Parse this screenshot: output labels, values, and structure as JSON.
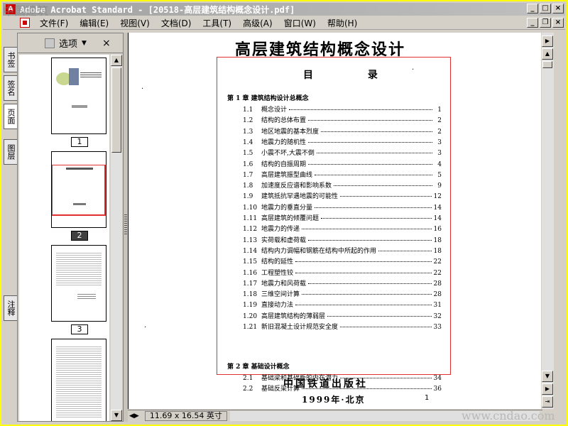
{
  "window": {
    "title": "Adobe Acrobat Standard - [20518-高层建筑结构概念设计.pdf]",
    "watermark_top": "中国建筑",
    "watermark_bottom": "www.cndao.com"
  },
  "menu": {
    "items": [
      "文件(F)",
      "编辑(E)",
      "视图(V)",
      "文档(D)",
      "工具(T)",
      "高级(A)",
      "窗口(W)",
      "帮助(H)"
    ]
  },
  "side_tabs": [
    "书签",
    "签名",
    "页面",
    "图层",
    "注释"
  ],
  "pages_panel": {
    "options_label": "选项",
    "thumbnails": [
      {
        "label": "1",
        "selected": false
      },
      {
        "label": "2",
        "selected": true
      },
      {
        "label": "3",
        "selected": false
      },
      {
        "label": "",
        "selected": false
      }
    ]
  },
  "status": {
    "page_size": "11.69 x 16.54 英寸"
  },
  "document": {
    "title": "高层建筑结构概念设计",
    "toc_heading": "目 录",
    "chapters": [
      {
        "title": "第 1 章   建筑结构设计总概念",
        "entries": [
          {
            "num": "1.1",
            "text": "概念设计",
            "page": "1"
          },
          {
            "num": "1.2",
            "text": "结构的总体布置",
            "page": "2"
          },
          {
            "num": "1.3",
            "text": "地区地震的基本烈度",
            "page": "2"
          },
          {
            "num": "1.4",
            "text": "地震力的随机性",
            "page": "3"
          },
          {
            "num": "1.5",
            "text": "小震不坏,大震不倒",
            "page": "3"
          },
          {
            "num": "1.6",
            "text": "结构的自振周期",
            "page": "4"
          },
          {
            "num": "1.7",
            "text": "高层建筑振型曲线",
            "page": "5"
          },
          {
            "num": "1.8",
            "text": "加速度反应谱和影响系数",
            "page": "9"
          },
          {
            "num": "1.9",
            "text": "建筑抵抗罕遇地震的可能性",
            "page": "12"
          },
          {
            "num": "1.10",
            "text": "地震力的垂直分量",
            "page": "14"
          },
          {
            "num": "1.11",
            "text": "高层建筑的倾覆问题",
            "page": "14"
          },
          {
            "num": "1.12",
            "text": "地震力的传递",
            "page": "16"
          },
          {
            "num": "1.13",
            "text": "实荷载和虚荷载",
            "page": "18"
          },
          {
            "num": "1.14",
            "text": "结构内力调幅和钢筋在结构中所起的作用",
            "page": "18"
          },
          {
            "num": "1.15",
            "text": "结构的延性",
            "page": "22"
          },
          {
            "num": "1.16",
            "text": "工程塑性铰",
            "page": "22"
          },
          {
            "num": "1.17",
            "text": "地震力和风荷载",
            "page": "28"
          },
          {
            "num": "1.18",
            "text": "三维空间计算",
            "page": "28"
          },
          {
            "num": "1.19",
            "text": "直接动力法",
            "page": "31"
          },
          {
            "num": "1.20",
            "text": "高层建筑结构的薄弱层",
            "page": "32"
          },
          {
            "num": "1.21",
            "text": "新旧混凝土设计规范安全度",
            "page": "33"
          }
        ]
      },
      {
        "title": "第 2 章   基础设计概念",
        "entries": [
          {
            "num": "2.1",
            "text": "基础梁和基础板的内在潜力",
            "page": "34"
          },
          {
            "num": "2.2",
            "text": "基础反梁计算",
            "page": "36"
          }
        ]
      }
    ],
    "page_number": "1",
    "publisher": "中国铁道出版社",
    "year_place": "1999年·北京"
  }
}
